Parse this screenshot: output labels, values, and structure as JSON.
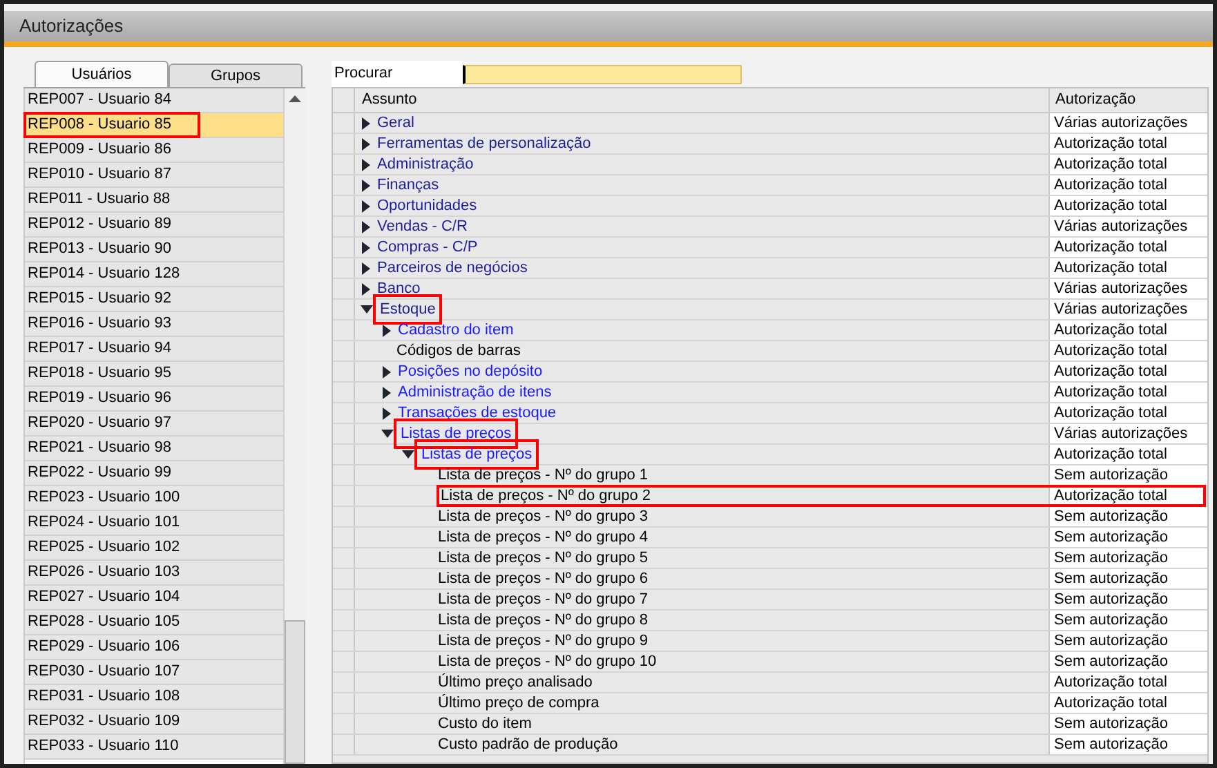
{
  "window": {
    "title": "Autorizações"
  },
  "tabs": [
    {
      "label": "Usuários",
      "selected": true
    },
    {
      "label": "Grupos",
      "selected": false
    }
  ],
  "users": [
    {
      "label": "REP007 - Usuario 84",
      "selected": false,
      "highlighted": false
    },
    {
      "label": "REP008 - Usuario 85",
      "selected": true,
      "highlighted": true
    },
    {
      "label": "REP009 - Usuario 86",
      "selected": false,
      "highlighted": false
    },
    {
      "label": "REP010 - Usuario 87",
      "selected": false,
      "highlighted": false
    },
    {
      "label": "REP011 - Usuario 88",
      "selected": false,
      "highlighted": false
    },
    {
      "label": "REP012 - Usuario 89",
      "selected": false,
      "highlighted": false
    },
    {
      "label": "REP013 - Usuario 90",
      "selected": false,
      "highlighted": false
    },
    {
      "label": "REP014 - Usuario 128",
      "selected": false,
      "highlighted": false
    },
    {
      "label": "REP015 - Usuario 92",
      "selected": false,
      "highlighted": false
    },
    {
      "label": "REP016 - Usuario 93",
      "selected": false,
      "highlighted": false
    },
    {
      "label": "REP017 - Usuario 94",
      "selected": false,
      "highlighted": false
    },
    {
      "label": "REP018 - Usuario 95",
      "selected": false,
      "highlighted": false
    },
    {
      "label": "REP019 - Usuario 96",
      "selected": false,
      "highlighted": false
    },
    {
      "label": "REP020 - Usuario 97",
      "selected": false,
      "highlighted": false
    },
    {
      "label": "REP021 - Usuario 98",
      "selected": false,
      "highlighted": false
    },
    {
      "label": "REP022 - Usuario 99",
      "selected": false,
      "highlighted": false
    },
    {
      "label": "REP023 - Usuario 100",
      "selected": false,
      "highlighted": false
    },
    {
      "label": "REP024 - Usuario 101",
      "selected": false,
      "highlighted": false
    },
    {
      "label": "REP025 - Usuario 102",
      "selected": false,
      "highlighted": false
    },
    {
      "label": "REP026 - Usuario 103",
      "selected": false,
      "highlighted": false
    },
    {
      "label": "REP027 - Usuario 104",
      "selected": false,
      "highlighted": false
    },
    {
      "label": "REP028 - Usuario 105",
      "selected": false,
      "highlighted": false
    },
    {
      "label": "REP029 - Usuario 106",
      "selected": false,
      "highlighted": false
    },
    {
      "label": "REP030 - Usuario 107",
      "selected": false,
      "highlighted": false
    },
    {
      "label": "REP031 - Usuario 108",
      "selected": false,
      "highlighted": false
    },
    {
      "label": "REP032 - Usuario 109",
      "selected": false,
      "highlighted": false
    },
    {
      "label": "REP033 - Usuario 110",
      "selected": false,
      "highlighted": false
    }
  ],
  "search": {
    "label": "Procurar"
  },
  "table": {
    "columns": [
      "Assunto",
      "Autorização"
    ],
    "rows": [
      {
        "label": "Geral",
        "authorization": "Várias autorizações",
        "expanded": false,
        "highlighted": false
      },
      {
        "label": "Ferramentas de personalização",
        "authorization": "Autorização total",
        "expanded": false,
        "highlighted": false
      },
      {
        "label": "Administração",
        "authorization": "Autorização total",
        "expanded": false,
        "highlighted": false
      },
      {
        "label": "Finanças",
        "authorization": "Autorização total",
        "expanded": false,
        "highlighted": false
      },
      {
        "label": "Oportunidades",
        "authorization": "Autorização total",
        "expanded": false,
        "highlighted": false
      },
      {
        "label": "Vendas - C/R",
        "authorization": "Várias autorizações",
        "expanded": false,
        "highlighted": false
      },
      {
        "label": "Compras - C/P",
        "authorization": "Autorização total",
        "expanded": false,
        "highlighted": false
      },
      {
        "label": "Parceiros de negócios",
        "authorization": "Autorização total",
        "expanded": false,
        "highlighted": false
      },
      {
        "label": "Banco",
        "authorization": "Várias autorizações",
        "expanded": false,
        "highlighted": false
      },
      {
        "label": "Estoque",
        "authorization": "Várias autorizações",
        "expanded": true,
        "highlighted": true,
        "children": [
          {
            "label": "Cadastro do item",
            "authorization": "Autorização total",
            "expanded": false,
            "highlighted": false
          },
          {
            "label": "Códigos de barras",
            "authorization": "Autorização total",
            "highlighted": false
          },
          {
            "label": "Posições no depósito",
            "authorization": "Autorização total",
            "expanded": false,
            "highlighted": false
          },
          {
            "label": "Administração de itens",
            "authorization": "Autorização total",
            "expanded": false,
            "highlighted": false
          },
          {
            "label": "Transações de estoque",
            "authorization": "Autorização total",
            "expanded": false,
            "highlighted": false
          },
          {
            "label": "Listas de preços",
            "authorization": "Várias autorizações",
            "expanded": true,
            "highlighted": true,
            "children": [
              {
                "label": "Listas de preços",
                "authorization": "Autorização total",
                "expanded": true,
                "highlighted": true,
                "children": [
                  {
                    "label": "Lista de preços - Nº do grupo 1",
                    "authorization": "Sem autorização",
                    "highlighted": false
                  },
                  {
                    "label": "Lista de preços - Nº do grupo 2",
                    "authorization": "Autorização total",
                    "highlighted": true
                  },
                  {
                    "label": "Lista de preços - Nº do grupo 3",
                    "authorization": "Sem autorização",
                    "highlighted": false
                  },
                  {
                    "label": "Lista de preços - Nº do grupo 4",
                    "authorization": "Sem autorização",
                    "highlighted": false
                  },
                  {
                    "label": "Lista de preços - Nº do grupo 5",
                    "authorization": "Sem autorização",
                    "highlighted": false
                  },
                  {
                    "label": "Lista de preços - Nº do grupo 6",
                    "authorization": "Sem autorização",
                    "highlighted": false
                  },
                  {
                    "label": "Lista de preços - Nº do grupo 7",
                    "authorization": "Sem autorização",
                    "highlighted": false
                  },
                  {
                    "label": "Lista de preços - Nº do grupo 8",
                    "authorization": "Sem autorização",
                    "highlighted": false
                  },
                  {
                    "label": "Lista de preços - Nº do grupo 9",
                    "authorization": "Sem autorização",
                    "highlighted": false
                  },
                  {
                    "label": "Lista de preços - Nº do grupo 10",
                    "authorization": "Sem autorização",
                    "highlighted": false
                  },
                  {
                    "label": "Último preço analisado",
                    "authorization": "Autorização total",
                    "highlighted": false
                  },
                  {
                    "label": "Último preço de compra",
                    "authorization": "Autorização total",
                    "highlighted": false
                  },
                  {
                    "label": "Custo do item",
                    "authorization": "Sem autorização",
                    "highlighted": false
                  },
                  {
                    "label": "Custo padrão de produção",
                    "authorization": "Sem autorização",
                    "highlighted": false
                  }
                ]
              }
            ]
          }
        ]
      }
    ]
  }
}
